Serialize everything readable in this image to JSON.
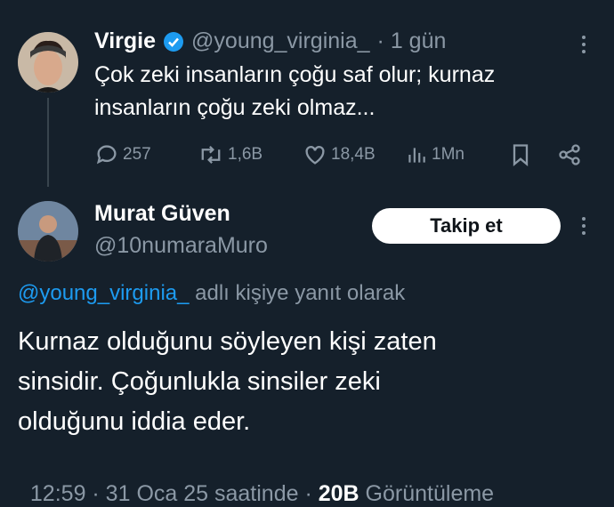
{
  "original_tweet": {
    "author_name": "Virgie",
    "verified": true,
    "handle": "@young_virginia_",
    "time": "· 1 gün",
    "text_line1": "Çok zeki insanların çoğu saf olur; kurnaz",
    "text_line2": "insanların çoğu zeki olmaz...",
    "actions": {
      "replies": "257",
      "retweets": "1,6B",
      "likes": "18,4B",
      "views": "1Mn"
    }
  },
  "reply_tweet": {
    "author_name": "Murat Güven",
    "handle": "@10numaraMuro",
    "follow_label": "Takip et",
    "reply_to_handle": "@young_virginia_",
    "reply_to_suffix": " adlı kişiye yanıt olarak",
    "text_line1": "Kurnaz olduğunu söyleyen kişi zaten",
    "text_line2": "sinsidir. Çoğunlukla sinsiler zeki",
    "text_line3": "olduğunu iddia eder.",
    "timestamp": "12:59 · 31 Oca 25 saatinde · ",
    "views_count": "20B",
    "views_label": " Görüntüleme"
  },
  "colors": {
    "background": "#15202b",
    "accent": "#1d9bf0",
    "muted": "#8b98a5"
  },
  "icons": [
    "verified-badge-icon",
    "more-icon",
    "reply-icon",
    "retweet-icon",
    "like-icon",
    "views-icon",
    "bookmark-icon",
    "share-icon"
  ]
}
